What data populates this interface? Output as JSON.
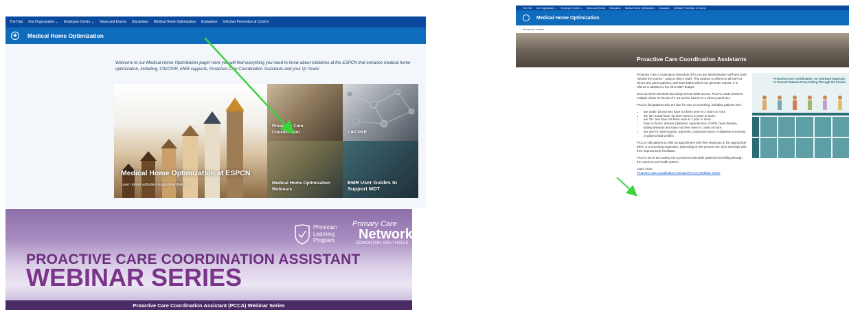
{
  "left": {
    "nav": [
      "The Hub",
      "Our Organization ⌄",
      "Employee Centre ⌄",
      "News and Events",
      "Disciplines",
      "Medical Home Optimization",
      "Evaluation",
      "Infection Prevention & Control"
    ],
    "site_title": "Medical Home Optimization",
    "welcome": "Welcome to our Medical Home Optimization page! Here you will find everything you need to know about initiatives at the ESPCN that enhance medical home optimization, including, CII/CPAR, EMR supports, Proactive Care Coordination Assistants and your QI Team!",
    "hero_title": "Medical Home Optimization at ESPCN",
    "hero_sub": "Learn about activities supporting MHO →",
    "tiles": [
      "Proactive Care Coordination",
      "CII/CPAR",
      "Medical Home Optimization Webinars",
      "EMR User Guides to Support MDT"
    ]
  },
  "banner": {
    "line1": "PROACTIVE CARE COORDINATION ASSISTANT",
    "line2": "WEBINAR SERIES",
    "plp": [
      "Physician",
      "Learning",
      "Program"
    ],
    "pcn_a": "Primary Care",
    "pcn_b": "Network",
    "pcn_c": "EDMONTON SOUTHSIDE",
    "bar": "Proactive Care Coordination Assistant (PCCA) Webinar Series"
  },
  "right": {
    "nav": [
      "The Hub",
      "Our Organization ⌄",
      "Employee Centre ⌄",
      "News and Events",
      "Disciplines",
      "Medical Home Optimization",
      "Evaluation",
      "Infection Prevention & Control"
    ],
    "site_title": "Medical Home Optimization",
    "reader": "Immersive reader",
    "hero_title": "Proactive Care Coordination Assistants",
    "p1": "Proactive Care Coordination Assistants (PCCAs) are administrative staff who work \"behind the scenes\", using a clinic's EMR. This position is offered to all ESPCN clinics who panel patients, and have EMRs which can generate reports. It is offered in addition to the clinic MDT budget.",
    "p2": "On a 12-week schedule and using remote EMR access, PCCAs rotate between multiple clinics for blocks of 1-12 weeks, based on a clinic's panel size.",
    "p3": "PCCAs find patients who are due for care or screening, including patients who:",
    "bullets": [
      "are under 18 and who have not been seen in 2 years or more.",
      "are 18-74 and have not been seen in 3 years or more.",
      "are 75+ and have not been seen in 1 year or more.",
      "have a chronic disease (diabetes, hypertension, COPD, heart disease, kidney disease) and have not been seen in 1 year or more.",
      "are due for mammogram, pap tests, colorectal cancer or diabetes screening, or plasma lipid profiles."
    ],
    "p4": "PCCAs call patients to offer an appointment with their physician or the appropriate MDT, or a screening requisition, depending on the process the clinic develops with their Improvement Facilitator.",
    "p5": "PCCAs serve as a safety net to prevent vulnerable patients from falling through the cracks in our health system.",
    "learn": "Learn more:",
    "link": "Proactive Care Coordination Assistant (PCCA) Webinar Series",
    "info_title": "Proactive Care Coordination: An Outreach Approach to Prevent Patients From Falling Through the Cracks"
  },
  "colors": {
    "suite": "#0a4a9e",
    "header": "#0f6cbd",
    "arrow": "#3cd33c",
    "banner_text": "#7a3489"
  }
}
